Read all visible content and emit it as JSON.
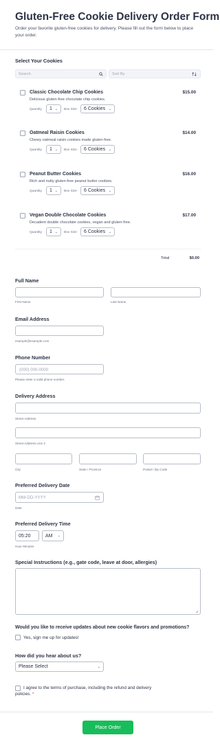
{
  "header": {
    "title": "Gluten-Free Cookie Delivery Order Form",
    "subtitle": "Order your favorite gluten-free cookies for delivery. Please fill out the form below to place your order."
  },
  "cookies": {
    "label": "Select Your Cookies",
    "search_placeholder": "Search",
    "sort_placeholder": "Sort By",
    "quantity_label": "Quantity",
    "box_size_label": "Box Size",
    "products": [
      {
        "name": "Classic Chocolate Chip Cookies",
        "desc": "Delicious gluten-free chocolate chip cookies.",
        "price": "$15.00",
        "quantity": "1",
        "box_size": "6 Cookies"
      },
      {
        "name": "Oatmeal Raisin Cookies",
        "desc": "Chewy oatmeal raisin cookies made gluten-free.",
        "price": "$14.00",
        "quantity": "1",
        "box_size": "6 Cookies"
      },
      {
        "name": "Peanut Butter Cookies",
        "desc": "Rich and nutty gluten-free peanut butter cookies.",
        "price": "$16.00",
        "quantity": "1",
        "box_size": "6 Cookies"
      },
      {
        "name": "Vegan Double Chocolate Cookies",
        "desc": "Decadent double chocolate cookies, vegan and gluten-free.",
        "price": "$17.00",
        "quantity": "1",
        "box_size": "6 Cookies"
      }
    ],
    "total_label": "Total",
    "total_value": "$0.00"
  },
  "full_name": {
    "label": "Full Name",
    "first_sublabel": "First Name",
    "last_sublabel": "Last Name"
  },
  "email": {
    "label": "Email Address",
    "sublabel": "example@example.com"
  },
  "phone": {
    "label": "Phone Number",
    "placeholder": "(000) 000-0000",
    "sublabel": "Please enter a valid phone number."
  },
  "address": {
    "label": "Delivery Address",
    "street_sublabel": "Street Address",
    "street2_sublabel": "Street Address Line 2",
    "city_sublabel": "City",
    "state_sublabel": "State / Province",
    "zip_sublabel": "Postal / Zip Code"
  },
  "date": {
    "label": "Preferred Delivery Date",
    "placeholder": "MM-DD-YYYY",
    "sublabel": "Date"
  },
  "time": {
    "label": "Preferred Delivery Time",
    "value": "05:20",
    "ampm": "AM",
    "sublabel": "Hour Minutes"
  },
  "instructions": {
    "label": "Special Instructions (e.g., gate code, leave at door, allergies)"
  },
  "updates": {
    "label": "Would you like to receive updates about new cookie flavors and promotions?",
    "option": "Yes, sign me up for updates!"
  },
  "referral": {
    "label": "How did you hear about us?",
    "value": "Please Select"
  },
  "terms": {
    "line1": "I agree to the terms of purchase, including the refund and delivery",
    "line2": "policies.",
    "required_mark": "*"
  },
  "submit": {
    "label": "Place Order"
  },
  "colors": {
    "accent": "#18bd5b",
    "required": "#f23a3c",
    "text": "#2c3345"
  }
}
